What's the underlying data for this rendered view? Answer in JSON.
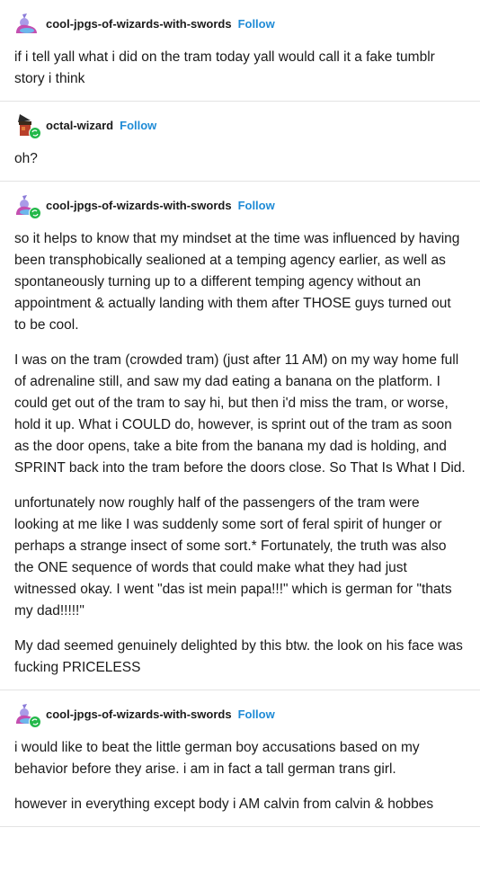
{
  "posts": [
    {
      "username": "cool-jpgs-of-wizards-with-swords",
      "follow_label": "Follow",
      "paragraphs": [
        "if i tell yall what i did on the tram today yall would call it a fake tumblr story i think"
      ]
    },
    {
      "username": "octal-wizard",
      "follow_label": "Follow",
      "paragraphs": [
        "oh?"
      ]
    },
    {
      "username": "cool-jpgs-of-wizards-with-swords",
      "follow_label": "Follow",
      "paragraphs": [
        "so it helps to know that my mindset at the time was influenced by having been transphobically sealioned at a temping agency earlier, as well as spontaneously turning up to a different temping agency without an appointment & actually landing with them after THOSE guys turned out to be cool.",
        "I was on the tram (crowded tram) (just after 11 AM)  on my way home full of adrenaline still, and saw my dad eating a banana on the platform. I could get out of the tram to say hi, but then i'd miss the tram, or worse, hold it up. What i COULD do, however, is sprint out of the tram as soon as the door opens, take a bite from the banana my dad is holding, and SPRINT back into the tram before the doors close. So That Is What I Did.",
        "unfortunately now roughly half of the passengers of the tram were looking at me like I was suddenly some sort of feral spirit of hunger or perhaps a strange insect of some sort.* Fortunately, the truth was also the ONE sequence of words that could make what they had just witnessed okay. I went \"das ist mein papa!!!\" which is german for \"thats my dad!!!!!\"",
        "My dad seemed genuinely delighted by this btw. the look on his face was fucking PRICELESS"
      ]
    },
    {
      "username": "cool-jpgs-of-wizards-with-swords",
      "follow_label": "Follow",
      "paragraphs": [
        "i would like to beat the little german boy accusations based on my behavior before they arise. i am in fact a tall german trans girl.",
        "however in everything except body i AM calvin from calvin & hobbes"
      ]
    }
  ],
  "colors": {
    "follow": "#1f8bd6",
    "reblog_badge": "#23b84a",
    "divider": "#e3e3e3"
  },
  "icons": {
    "avatar_wizard": "wizard-avatar-icon",
    "avatar_octal": "octal-wizard-avatar-icon",
    "reblog": "reblog-icon"
  }
}
